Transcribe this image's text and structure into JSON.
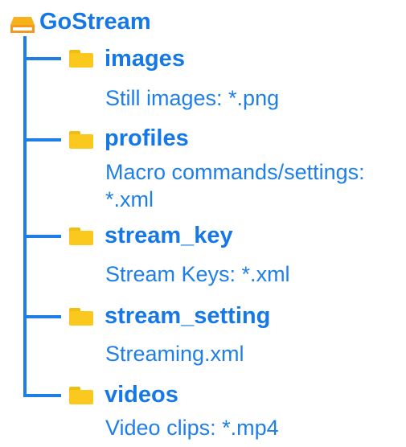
{
  "root": {
    "label": "GoStream",
    "icon": "drive-icon"
  },
  "items": [
    {
      "name": "images",
      "description": "Still images: *.png"
    },
    {
      "name": "profiles",
      "description_line1": "Macro commands/settings:",
      "description_line2": "*.xml"
    },
    {
      "name": "stream_key",
      "description": "Stream Keys: *.xml"
    },
    {
      "name": "stream_setting",
      "description": "Streaming.xml"
    },
    {
      "name": "videos",
      "description": "Video clips: *.mp4"
    }
  ],
  "colors": {
    "line": "#1f7ee6",
    "text": "#1578e6",
    "folder": "#fbc91d",
    "drive": "#f4a21e"
  }
}
